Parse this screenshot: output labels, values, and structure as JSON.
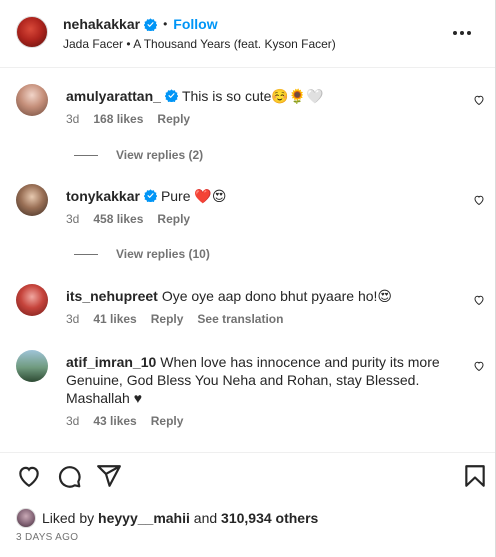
{
  "header": {
    "username": "nehakakkar",
    "follow_label": "Follow",
    "separator": "•",
    "audio": "Jada Facer • A Thousand Years (feat. Kyson Facer)"
  },
  "comments": [
    {
      "username": "amulyarattan_",
      "verified": true,
      "text": "This is so cute☺️🌻🤍",
      "age": "3d",
      "likes": "168 likes",
      "reply_label": "Reply",
      "view_replies": "View replies (2)"
    },
    {
      "username": "tonykakkar",
      "verified": true,
      "text": "Pure ❤️😍",
      "age": "3d",
      "likes": "458 likes",
      "reply_label": "Reply",
      "view_replies": "View replies (10)"
    },
    {
      "username": "its_nehupreet",
      "verified": false,
      "text": "Oye oye aap dono bhut pyaare ho!😍",
      "age": "3d",
      "likes": "41 likes",
      "reply_label": "Reply",
      "translate_label": "See translation"
    },
    {
      "username": "atif_imran_10",
      "verified": false,
      "text": "When love has innocence and purity its more Genuine, God Bless You Neha and Rohan, stay Blessed. Mashallah ♥",
      "age": "3d",
      "likes": "43 likes",
      "reply_label": "Reply"
    }
  ],
  "footer": {
    "liked_prefix": "Liked by",
    "liked_user": "heyyy__mahii",
    "liked_and": "and",
    "liked_count": "310,934 others",
    "posted_ago": "3 DAYS AGO"
  },
  "colors": {
    "accent": "#0095f6",
    "verified_badge": "#0095f6",
    "text": "#262626",
    "secondary": "#737373"
  },
  "icons": [
    "more-options-icon",
    "verified-icon",
    "heart-icon",
    "comment-icon",
    "share-icon",
    "bookmark-icon"
  ]
}
